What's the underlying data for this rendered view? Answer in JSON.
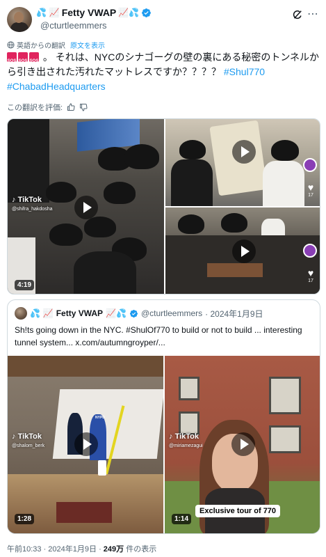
{
  "post": {
    "author": {
      "name": "Fetty VWAP",
      "emoji_prefix": "💦 📈",
      "emoji_suffix": "📈💦",
      "handle": "@cturtleemmers",
      "verified": true
    },
    "icons": {
      "grok": "grok-icon",
      "more": "more-icon",
      "verified": "verified-badge-icon"
    },
    "translation": {
      "note": "英語からの翻訳",
      "show_original": "原文を表示"
    },
    "text": "。 それは、NYCのシナゴーグの壁の裏にある秘密のトンネルから引き出された汚れたマットレスですか？？？？",
    "hashtags": [
      "#Shul770",
      "#ChabadHeadquarters"
    ],
    "rate": {
      "label": "この翻訳を評価:"
    },
    "media": [
      {
        "duration": "4:19",
        "tiktok_label": "TikTok",
        "tiktok_user": "@shifra_hakdosha"
      },
      {
        "like_count": "17"
      },
      {
        "like_count": "17"
      }
    ],
    "quote": {
      "author": {
        "name": "Fetty VWAP",
        "emoji_prefix": "💦 📈",
        "emoji_suffix": "📈💦",
        "handle": "@cturtleemmers",
        "date": "· 2024年1月9日"
      },
      "text": "Sh!ts going down in the NYC. #ShulOf770 to build or not to build ... interesting tunnel system...",
      "link": "x.com/autumngroyper/...",
      "media": [
        {
          "duration": "1:28",
          "tiktok_label": "TikTok",
          "tiktok_user": "@shalom_berk",
          "sign_text": "NYPD"
        },
        {
          "duration": "1:14",
          "tiktok_label": "TikTok",
          "tiktok_user": "@miriamezagui",
          "caption": "Exclusive tour of 770"
        }
      ]
    },
    "footer": {
      "time": "午前10:33 · 2024年1月9日 · ",
      "views_count": "249万",
      "views_label": " 件の表示"
    }
  }
}
